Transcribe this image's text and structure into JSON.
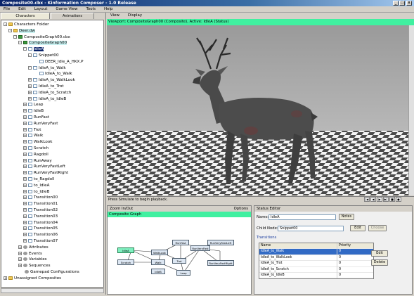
{
  "window": {
    "title": "Composite00.cbx - Kinformation Composer - 1.0 Release",
    "controls": [
      "_",
      "□",
      "x"
    ]
  },
  "menu": [
    "File",
    "Edit",
    "Layout",
    "Game View",
    "Tools",
    "Help"
  ],
  "left_panel": {
    "tabs": [
      "Characters",
      "Animations"
    ],
    "tree": [
      {
        "label": "Characters Folder",
        "icon": "folder-icon",
        "level": 0,
        "exp": "-"
      },
      {
        "label": "Deer.dw",
        "icon": "folder-icon",
        "level": 1,
        "exp": "-",
        "hl": true
      },
      {
        "label": "CompositeGraph00.cbx",
        "icon": "comp-icon",
        "level": 2,
        "exp": "-"
      },
      {
        "label": "CompositeGraph00",
        "icon": "comp-icon",
        "level": 3,
        "exp": "-",
        "hl": true
      },
      {
        "label": "IdleA",
        "icon": "anim-icon",
        "level": 4,
        "exp": "-",
        "sel": true
      },
      {
        "label": "Snippet00",
        "icon": "anim-icon",
        "level": 5,
        "exp": "-"
      },
      {
        "label": "DEER_Idle_A_HKX.P",
        "icon": "anim-icon",
        "level": 6,
        "exp": ""
      },
      {
        "label": "IdleA_to_Walk",
        "icon": "anim-icon",
        "level": 5,
        "exp": "-"
      },
      {
        "label": "IdleA_to_Walk",
        "icon": "anim-icon",
        "level": 6,
        "exp": ""
      },
      {
        "label": "IdleA_to_WalkLook",
        "icon": "anim-icon",
        "level": 5,
        "exp": "+"
      },
      {
        "label": "IdleA_to_Trot",
        "icon": "anim-icon",
        "level": 5,
        "exp": "+"
      },
      {
        "label": "IdleA_to_Scratch",
        "icon": "anim-icon",
        "level": 5,
        "exp": "+"
      },
      {
        "label": "IdleA_to_IdleB",
        "icon": "anim-icon",
        "level": 5,
        "exp": "+"
      },
      {
        "label": "Leap",
        "icon": "anim-icon",
        "level": 4,
        "exp": "+"
      },
      {
        "label": "IdleB",
        "icon": "anim-icon",
        "level": 4,
        "exp": "+"
      },
      {
        "label": "RunFast",
        "icon": "anim-icon",
        "level": 4,
        "exp": "+"
      },
      {
        "label": "RunVeryFast",
        "icon": "anim-icon",
        "level": 4,
        "exp": "+"
      },
      {
        "label": "Trot",
        "icon": "anim-icon",
        "level": 4,
        "exp": "+"
      },
      {
        "label": "Walk",
        "icon": "anim-icon",
        "level": 4,
        "exp": "+"
      },
      {
        "label": "WalkLook",
        "icon": "anim-icon",
        "level": 4,
        "exp": "+"
      },
      {
        "label": "Scratch",
        "icon": "anim-icon",
        "level": 4,
        "exp": "+"
      },
      {
        "label": "Ragdoll",
        "icon": "anim-icon",
        "level": 4,
        "exp": "+"
      },
      {
        "label": "RunAway",
        "icon": "anim-icon",
        "level": 4,
        "exp": "+"
      },
      {
        "label": "RunVeryFastLeft",
        "icon": "anim-icon",
        "level": 4,
        "exp": "+"
      },
      {
        "label": "RunVeryFastRight",
        "icon": "anim-icon",
        "level": 4,
        "exp": "+"
      },
      {
        "label": "to_Ragdoll",
        "icon": "anim-icon",
        "level": 4,
        "exp": "+"
      },
      {
        "label": "to_IdleA",
        "icon": "anim-icon",
        "level": 4,
        "exp": "+"
      },
      {
        "label": "to_IdleB",
        "icon": "anim-icon",
        "level": 4,
        "exp": "+"
      },
      {
        "label": "Transition00",
        "icon": "anim-icon",
        "level": 4,
        "exp": "+"
      },
      {
        "label": "Transition01",
        "icon": "anim-icon",
        "level": 4,
        "exp": "+"
      },
      {
        "label": "Transition02",
        "icon": "anim-icon",
        "level": 4,
        "exp": "+"
      },
      {
        "label": "Transition03",
        "icon": "anim-icon",
        "level": 4,
        "exp": "+"
      },
      {
        "label": "Transition04",
        "icon": "anim-icon",
        "level": 4,
        "exp": "+"
      },
      {
        "label": "Transition05",
        "icon": "anim-icon",
        "level": 4,
        "exp": "+"
      },
      {
        "label": "Transition06",
        "icon": "anim-icon",
        "level": 4,
        "exp": "+"
      },
      {
        "label": "Transition07",
        "icon": "anim-icon",
        "level": 4,
        "exp": "+"
      },
      {
        "label": "Attributes",
        "icon": "gear-icon",
        "level": 3,
        "exp": "+"
      },
      {
        "label": "Events",
        "icon": "gear-icon",
        "level": 3,
        "exp": "+"
      },
      {
        "label": "Variables",
        "icon": "gear-icon",
        "level": 3,
        "exp": "+"
      },
      {
        "label": "Sequences",
        "icon": "gear-icon",
        "level": 3,
        "exp": "+"
      },
      {
        "label": "Gamepad Configurations",
        "icon": "gear-icon",
        "level": 3,
        "exp": ""
      },
      {
        "label": "Unassigned Composites",
        "icon": "folder-icon",
        "level": 0,
        "exp": "+"
      }
    ]
  },
  "viewport": {
    "menu": [
      "View",
      "Display"
    ],
    "header": "Viewport: CompositeGraph00 (Composite), Active: IdleA (Status)",
    "status": "Press Simulate to begin playback.",
    "playback_buttons": [
      "|◀",
      "◀",
      "▶",
      "▶|",
      "■",
      "●"
    ]
  },
  "composite_graph": {
    "toolbar_left": "Zoom In/Out",
    "toolbar_right": "Options",
    "title": "Composite Graph",
    "nodes": [
      "IdleA",
      "Scratch",
      "WalkLook",
      "Walk",
      "RunFast",
      "Trot",
      "IdleB",
      "RunVeryFast",
      "RunVeryFastLeft",
      "RunVeryFastRight",
      "Leap"
    ]
  },
  "status_editor": {
    "title": "Status Editor",
    "name_label": "Name:",
    "name_value": "IdleA",
    "notes_button": "Notes",
    "child_label": "Child Node:",
    "child_value": "Snippet00",
    "edit_button": "Edit",
    "choose_button": "Choose",
    "transitions_label": "Transitions",
    "columns": [
      "Name",
      "Priority"
    ],
    "rows": [
      {
        "name": "IdleA_to_Walk",
        "priority": "0"
      },
      {
        "name": "IdleA_to_WalkLook",
        "priority": "0"
      },
      {
        "name": "IdleA_to_Trot",
        "priority": "0"
      },
      {
        "name": "IdleA_to_Scratch",
        "priority": "0"
      },
      {
        "name": "IdleA_to_IdleB",
        "priority": "0"
      }
    ],
    "edit2_button": "Edit",
    "delete_button": "Delete"
  }
}
